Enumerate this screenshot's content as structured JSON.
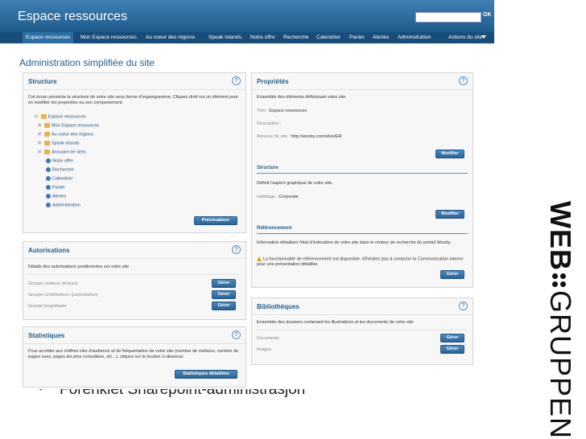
{
  "app": {
    "title": "Espace ressources",
    "search_ok": "OK"
  },
  "nav": {
    "items": [
      "Espace ressources",
      "Mon Espace ressources",
      "Au coeur des régions",
      "Speak Islands",
      "Notre offre",
      "Recherche",
      "Calendrier",
      "Panier",
      "Alertes",
      "Administration"
    ],
    "actions": "Actions du site"
  },
  "page_title": "Administration simplifiée du site",
  "structure": {
    "title": "Structure",
    "desc": "Cet écran présente la structure de votre site sous forme d'organigramme. Cliquez droit sur un élément pour en modifier les propriétés ou son comportement.",
    "tree": [
      "Espace ressources",
      "Mon Espace ressources",
      "Au coeur des régions",
      "Speak Islands",
      "Annuaire de sites",
      "Notre offre",
      "Recherche",
      "Calendrier",
      "Panier",
      "Alertes",
      "Administration"
    ],
    "button": "Prévisualiser"
  },
  "autorisations": {
    "title": "Autorisations",
    "desc": "Détails des autorisations positionnées sur votre site",
    "rows": [
      "Groupe visiteurs (lecture)",
      "Groupe contributeurs (participation)",
      "Groupe propriétaire"
    ],
    "button": "Gérer"
  },
  "statistiques": {
    "title": "Statistiques",
    "desc": "Pour accéder aux chiffres clés d'audience et de fréquentation de votre site (nombre de visiteurs, nombre de pages vues, pages les plus consultées, etc...), cliquez sur le bouton ci-dessous.",
    "button": "Statistiques détaillées"
  },
  "proprietes": {
    "title": "Propriétés",
    "desc": "Ensemble des éléments définissant votre site",
    "titre_label": "Titre :",
    "titre_value": "Espace ressources",
    "description_label": "Description :",
    "adresse_label": "Adresse du site :",
    "adresse_value": "http://wooby.com/sites/ER",
    "button": "Modifier",
    "structure_title": "Structure",
    "structure_desc": "Définit l'aspect graphique de votre site.",
    "habillage_label": "Habillage :",
    "habillage_value": "Corporate",
    "button2": "Modifier",
    "ref_title": "Référencement",
    "ref_desc": "Information détaillant l'état d'indexation de votre site dans le moteur de recherche du portail Wooby.",
    "ref_warning": "La fonctionnalité de référencement est disponible. N'hésitez pas à contacter la Communication interne pour une présentation détaillée",
    "button3": "Gérer"
  },
  "bibliotheques": {
    "title": "Bibliothèques",
    "desc": "Ensemble des dossiers contenant les illustrations et les documents de votre site",
    "rows": [
      "Documents",
      "Images"
    ],
    "button": "Gérer"
  },
  "help_glyph": "?",
  "slide": {
    "bullet_text": "Forenklet Sharepoint-administrasjon",
    "logo_web": "WEB",
    "logo_gruppen": "GRUPPEN"
  }
}
